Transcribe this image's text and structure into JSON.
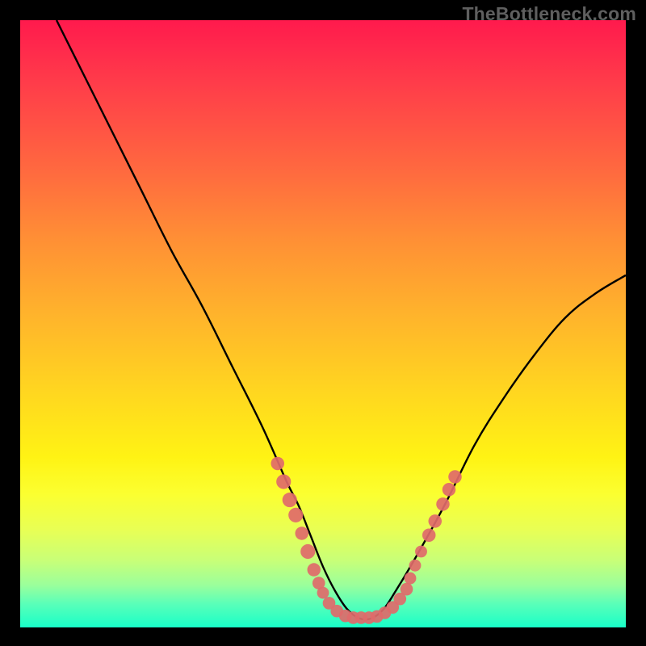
{
  "watermark": "TheBottleneck.com",
  "chart_data": {
    "type": "line",
    "title": "",
    "xlabel": "",
    "ylabel": "",
    "xlim": [
      0,
      100
    ],
    "ylim": [
      0,
      100
    ],
    "series": [
      {
        "name": "curve",
        "x": [
          6,
          10,
          15,
          20,
          25,
          30,
          35,
          40,
          44,
          46,
          48,
          50,
          52,
          54,
          56,
          58,
          60,
          62,
          65,
          70,
          75,
          80,
          85,
          90,
          95,
          100
        ],
        "y": [
          100,
          92,
          82,
          72,
          62,
          53,
          43,
          33,
          24,
          20,
          15,
          10,
          6,
          3,
          1.5,
          1.5,
          3,
          6,
          11,
          20,
          30,
          38,
          45,
          51,
          55,
          58
        ]
      }
    ],
    "markers": [
      {
        "x": 42.5,
        "y": 27,
        "r": 2.0
      },
      {
        "x": 43.5,
        "y": 24,
        "r": 2.2
      },
      {
        "x": 44.5,
        "y": 21,
        "r": 2.2
      },
      {
        "x": 45.5,
        "y": 18.5,
        "r": 2.2
      },
      {
        "x": 46.5,
        "y": 15.5,
        "r": 2.0
      },
      {
        "x": 47.5,
        "y": 12.5,
        "r": 2.2
      },
      {
        "x": 48.5,
        "y": 9.5,
        "r": 2.0
      },
      {
        "x": 49.3,
        "y": 7.3,
        "r": 1.9
      },
      {
        "x": 50.0,
        "y": 5.7,
        "r": 1.8
      },
      {
        "x": 51.0,
        "y": 4.0,
        "r": 1.9
      },
      {
        "x": 52.3,
        "y": 2.7,
        "r": 1.9
      },
      {
        "x": 53.7,
        "y": 1.9,
        "r": 1.9
      },
      {
        "x": 55.0,
        "y": 1.6,
        "r": 1.9
      },
      {
        "x": 56.3,
        "y": 1.6,
        "r": 1.9
      },
      {
        "x": 57.6,
        "y": 1.6,
        "r": 1.9
      },
      {
        "x": 58.9,
        "y": 1.8,
        "r": 1.9
      },
      {
        "x": 60.2,
        "y": 2.4,
        "r": 1.9
      },
      {
        "x": 61.5,
        "y": 3.3,
        "r": 1.9
      },
      {
        "x": 62.7,
        "y": 4.7,
        "r": 1.9
      },
      {
        "x": 63.8,
        "y": 6.3,
        "r": 1.9
      },
      {
        "x": 64.4,
        "y": 8.1,
        "r": 1.8
      },
      {
        "x": 65.2,
        "y": 10.2,
        "r": 1.8
      },
      {
        "x": 66.2,
        "y": 12.5,
        "r": 1.8
      },
      {
        "x": 67.5,
        "y": 15.2,
        "r": 2.0
      },
      {
        "x": 68.5,
        "y": 17.5,
        "r": 2.0
      },
      {
        "x": 69.8,
        "y": 20.3,
        "r": 2.0
      },
      {
        "x": 70.8,
        "y": 22.7,
        "r": 2.0
      },
      {
        "x": 71.8,
        "y": 24.8,
        "r": 2.0
      }
    ],
    "marker_color": "#e06a6a",
    "curve_color": "#000000"
  }
}
